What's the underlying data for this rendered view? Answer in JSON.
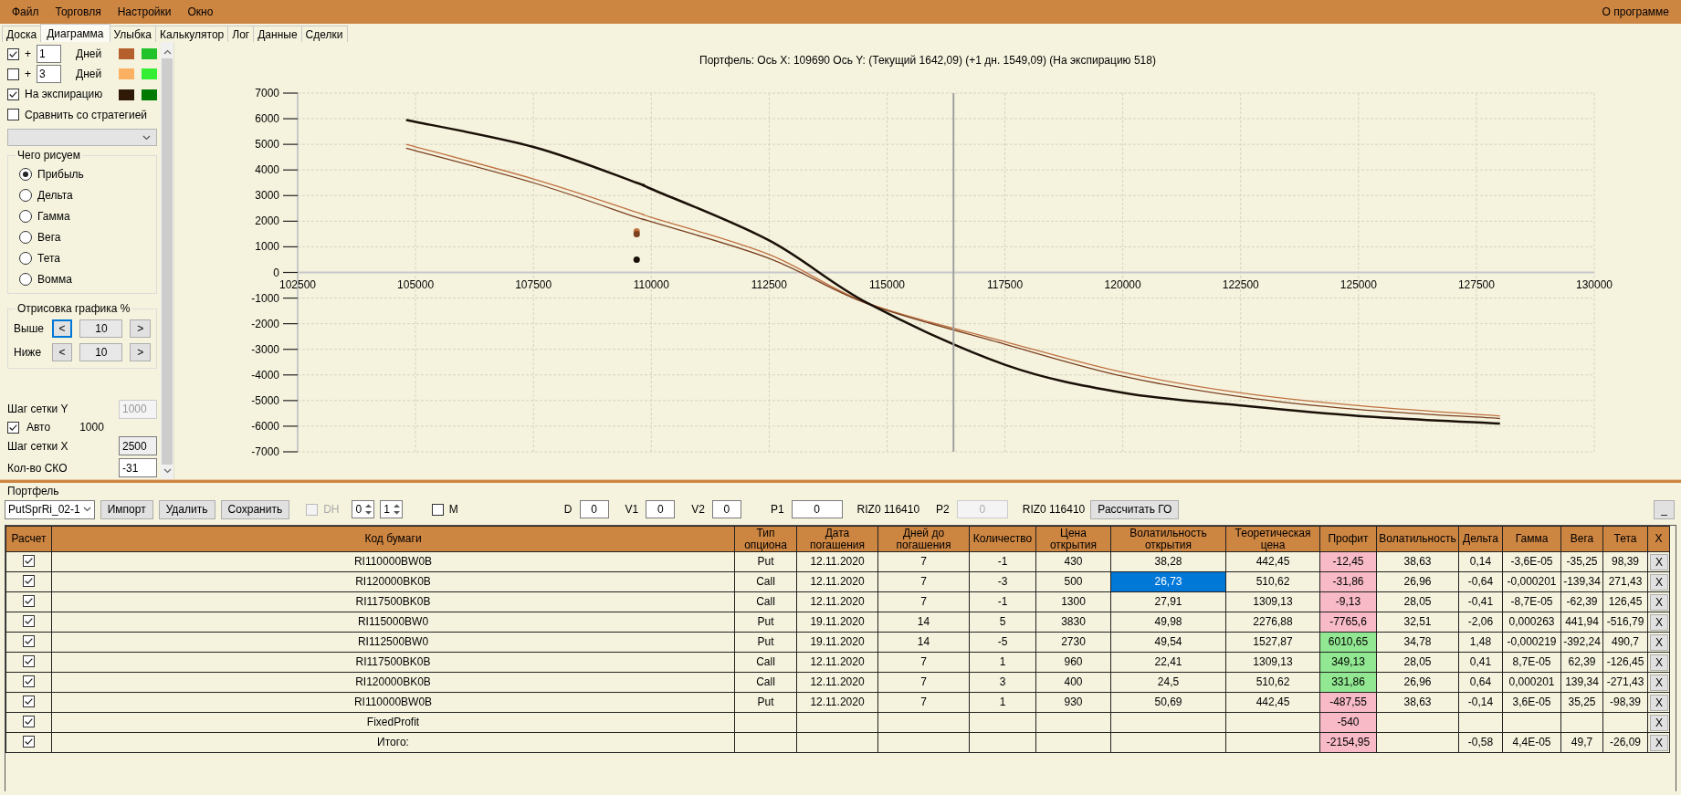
{
  "menu": {
    "items": [
      "Файл",
      "Торговля",
      "Настройки",
      "Окно"
    ],
    "about": "О программе"
  },
  "tabs": [
    {
      "label": "Доска",
      "selected": false
    },
    {
      "label": "Диаграмма",
      "selected": true
    },
    {
      "label": "Улыбка",
      "selected": false
    },
    {
      "label": "Калькулятор",
      "selected": false
    },
    {
      "label": "Лог",
      "selected": false
    },
    {
      "label": "Данные",
      "selected": false
    },
    {
      "label": "Сделки",
      "selected": false
    }
  ],
  "settings": {
    "curve_rows": [
      {
        "kind": "days",
        "checked": true,
        "sign": "+",
        "days": "1",
        "unit": "Дней",
        "swatches": [
          {
            "color": "#b5602c"
          },
          {
            "color": "#22c22a"
          }
        ]
      },
      {
        "kind": "days",
        "checked": false,
        "sign": "+",
        "days": "3",
        "unit": "Дней",
        "swatches": [
          {
            "color": "#fbb062"
          },
          {
            "color": "#33ee33"
          }
        ]
      },
      {
        "kind": "expiry",
        "checked": true,
        "label": "На экспирацию",
        "swatches": [
          {
            "color": "#301806"
          },
          {
            "color": "#007a00"
          }
        ]
      }
    ],
    "compare": {
      "label": "Сравнить со стратегией",
      "checked": false
    },
    "draw_group": {
      "title": "Чего рисуем",
      "options": [
        {
          "label": "Прибыль",
          "selected": true
        },
        {
          "label": "Дельта",
          "selected": false
        },
        {
          "label": "Гамма",
          "selected": false
        },
        {
          "label": "Вега",
          "selected": false
        },
        {
          "label": "Тета",
          "selected": false
        },
        {
          "label": "Вомма",
          "selected": false
        }
      ]
    },
    "range_group": {
      "title": "Отрисовка графика %",
      "rows": [
        {
          "label": "Выше",
          "dec": "<",
          "value": "10",
          "inc": ">",
          "focused": true
        },
        {
          "label": "Ниже",
          "dec": "<",
          "value": "10",
          "inc": ">",
          "focused": false
        }
      ]
    },
    "grid_y": {
      "label": "Шаг сетки Y",
      "value": "1000",
      "disabled": true
    },
    "auto": {
      "label": "Авто",
      "checked": true,
      "value": "1000"
    },
    "grid_x": {
      "label": "Шаг сетки X",
      "value": "2500",
      "readonly": true
    },
    "sko": {
      "label": "Кол-во СКО",
      "value": "-31"
    }
  },
  "chart": {
    "chart_data": {
      "type": "line",
      "title": "Портфель: Ось X: 109690 Ось Y:  (Текущий 1642,09)  (+1 дн. 1549,09)  (На экспирацию 518)",
      "x": [
        104800,
        107500,
        109690,
        110000,
        112500,
        114600,
        117500,
        120000,
        122500,
        125000,
        128000
      ],
      "series": [
        {
          "color": "#c07040",
          "values": [
            5000,
            3650,
            2350,
            2150,
            700,
            -1210,
            -2700,
            -3900,
            -4700,
            -5200,
            -5600
          ]
        },
        {
          "color": "#7a4020",
          "values": [
            4850,
            3500,
            2150,
            1980,
            550,
            -1230,
            -2800,
            -4050,
            -4850,
            -5350,
            -5700
          ]
        },
        {
          "color": "#1a1008",
          "values": [
            5950,
            4900,
            3500,
            3260,
            1250,
            -1210,
            -3600,
            -4690,
            -5190,
            -5600,
            -5900
          ]
        },
        {
          "color": "#c07040",
          "marker": true,
          "values": [
            null,
            null,
            1600,
            null,
            null,
            null,
            null,
            null,
            null,
            null,
            null
          ]
        },
        {
          "color": "#7a4020",
          "marker": true,
          "values": [
            null,
            null,
            1500,
            null,
            null,
            null,
            null,
            null,
            null,
            null,
            null
          ]
        },
        {
          "color": "#1a1008",
          "marker": true,
          "values": [
            null,
            null,
            500,
            null,
            null,
            null,
            null,
            null,
            null,
            null,
            null
          ]
        }
      ],
      "xlim": [
        102500,
        130000
      ],
      "ylim": [
        -7000,
        7000
      ],
      "grid": true,
      "xticks": [
        {
          "value": 102500,
          "label": "102500"
        },
        {
          "value": 105000,
          "label": "105000"
        },
        {
          "value": 107500,
          "label": "107500"
        },
        {
          "value": 110000,
          "label": "110000"
        },
        {
          "value": 112500,
          "label": "112500"
        },
        {
          "value": 115000,
          "label": "115000"
        },
        {
          "value": 117500,
          "label": "117500"
        },
        {
          "value": 120000,
          "label": "120000"
        },
        {
          "value": 122500,
          "label": "122500"
        },
        {
          "value": 125000,
          "label": "125000"
        },
        {
          "value": 127500,
          "label": "127500"
        },
        {
          "value": 130000,
          "label": "130000"
        }
      ],
      "yticks": [
        {
          "value": -7000,
          "label": "-7000"
        },
        {
          "value": -6000,
          "label": "-6000"
        },
        {
          "value": -5000,
          "label": "-5000"
        },
        {
          "value": -4000,
          "label": "-4000"
        },
        {
          "value": -3000,
          "label": "-3000"
        },
        {
          "value": -2000,
          "label": "-2000"
        },
        {
          "value": -1000,
          "label": "-1000"
        },
        {
          "value": 0,
          "label": "0"
        },
        {
          "value": 1000,
          "label": "1000"
        },
        {
          "value": 2000,
          "label": "2000"
        },
        {
          "value": 3000,
          "label": "3000"
        },
        {
          "value": 4000,
          "label": "4000"
        },
        {
          "value": 5000,
          "label": "5000"
        },
        {
          "value": 6000,
          "label": "6000"
        },
        {
          "value": 7000,
          "label": "7000"
        }
      ],
      "ref_lines": [
        {
          "axis": "x",
          "value": 116410
        }
      ]
    }
  },
  "portfolio": {
    "title": "Портфель",
    "toolbar": {
      "portfolio_select": "PutSprRi_02-1",
      "buttons": [
        "Импорт",
        "Удалить",
        "Сохранить"
      ],
      "dh": {
        "label": "DH",
        "checked": false,
        "disabled": true
      },
      "spinners": [
        "0",
        "1"
      ],
      "m": {
        "label": "M",
        "checked": false,
        "disabled": false
      },
      "fields": [
        {
          "kind": "field",
          "label": "D",
          "value": "0",
          "disabled": false
        },
        {
          "kind": "field",
          "label": "V1",
          "value": "0",
          "disabled": false
        },
        {
          "kind": "field",
          "label": "V2",
          "value": "0",
          "disabled": false
        },
        {
          "kind": "field",
          "label": "P1",
          "value": "0",
          "disabled": false
        },
        {
          "kind": "quote",
          "text": "RIZ0 116410"
        },
        {
          "kind": "field",
          "label": "P2",
          "value": "0",
          "disabled": true
        },
        {
          "kind": "quote",
          "text": "RIZ0 116410"
        }
      ],
      "calc_button": "Рассчитать ГО",
      "minimize_button": "_"
    },
    "table": {
      "columns": [
        "Расчет",
        "Код бумаги",
        "Тип опциона",
        "Дата погашения",
        "Дней до погашения",
        "Количество",
        "Цена открытия",
        "Волатильность открытия",
        "Теоретическая цена",
        "Профит",
        "Волатильность",
        "Дельта",
        "Гамма",
        "Вега",
        "Тета",
        "X"
      ],
      "rows": [
        {
          "calc": true,
          "code": "RI110000BW0B",
          "type": "Put",
          "date": "12.11.2020",
          "days": "7",
          "qty": "-1",
          "open_price": "430",
          "open_vol": "38,28",
          "open_vol_selected": false,
          "theor": "442,45",
          "profit": "-12,45",
          "color": "#f7bac6",
          "vol": "38,63",
          "delta": "0,14",
          "gamma": "-3,6E-05",
          "vega": "-35,25",
          "theta": "98,39",
          "del": "X"
        },
        {
          "calc": true,
          "code": "RI120000BK0B",
          "type": "Call",
          "date": "12.11.2020",
          "days": "7",
          "qty": "-3",
          "open_price": "500",
          "open_vol": "26,73",
          "open_vol_selected": true,
          "theor": "510,62",
          "profit": "-31,86",
          "color": "#f7bac6",
          "vol": "26,96",
          "delta": "-0,64",
          "gamma": "-0,000201",
          "vega": "-139,34",
          "theta": "271,43",
          "del": "X"
        },
        {
          "calc": true,
          "code": "RI117500BK0B",
          "type": "Call",
          "date": "12.11.2020",
          "days": "7",
          "qty": "-1",
          "open_price": "1300",
          "open_vol": "27,91",
          "open_vol_selected": false,
          "theor": "1309,13",
          "profit": "-9,13",
          "color": "#f7bac6",
          "vol": "28,05",
          "delta": "-0,41",
          "gamma": "-8,7E-05",
          "vega": "-62,39",
          "theta": "126,45",
          "del": "X"
        },
        {
          "calc": true,
          "code": "RI115000BW0",
          "type": "Put",
          "date": "19.11.2020",
          "days": "14",
          "qty": "5",
          "open_price": "3830",
          "open_vol": "49,98",
          "open_vol_selected": false,
          "theor": "2276,88",
          "profit": "-7765,6",
          "color": "#f7bac6",
          "vol": "32,51",
          "delta": "-2,06",
          "gamma": "0,000263",
          "vega": "441,94",
          "theta": "-516,79",
          "del": "X"
        },
        {
          "calc": true,
          "code": "RI112500BW0",
          "type": "Put",
          "date": "19.11.2020",
          "days": "14",
          "qty": "-5",
          "open_price": "2730",
          "open_vol": "49,54",
          "open_vol_selected": false,
          "theor": "1527,87",
          "profit": "6010,65",
          "color": "#92e892",
          "vol": "34,78",
          "delta": "1,48",
          "gamma": "-0,000219",
          "vega": "-392,24",
          "theta": "490,7",
          "del": "X"
        },
        {
          "calc": true,
          "code": "RI117500BK0B",
          "type": "Call",
          "date": "12.11.2020",
          "days": "7",
          "qty": "1",
          "open_price": "960",
          "open_vol": "22,41",
          "open_vol_selected": false,
          "theor": "1309,13",
          "profit": "349,13",
          "color": "#92e892",
          "vol": "28,05",
          "delta": "0,41",
          "gamma": "8,7E-05",
          "vega": "62,39",
          "theta": "-126,45",
          "del": "X"
        },
        {
          "calc": true,
          "code": "RI120000BK0B",
          "type": "Call",
          "date": "12.11.2020",
          "days": "7",
          "qty": "3",
          "open_price": "400",
          "open_vol": "24,5",
          "open_vol_selected": false,
          "theor": "510,62",
          "profit": "331,86",
          "color": "#92e892",
          "vol": "26,96",
          "delta": "0,64",
          "gamma": "0,000201",
          "vega": "139,34",
          "theta": "-271,43",
          "del": "X"
        },
        {
          "calc": true,
          "code": "RI110000BW0B",
          "type": "Put",
          "date": "12.11.2020",
          "days": "7",
          "qty": "1",
          "open_price": "930",
          "open_vol": "50,69",
          "open_vol_selected": false,
          "theor": "442,45",
          "profit": "-487,55",
          "color": "#f7bac6",
          "vol": "38,63",
          "delta": "-0,14",
          "gamma": "3,6E-05",
          "vega": "35,25",
          "theta": "-98,39",
          "del": "X"
        },
        {
          "calc": true,
          "code": "FixedProfit",
          "profit": "-540",
          "color": "#f7bac6",
          "del": "X"
        },
        {
          "calc": true,
          "code": "Итого:",
          "profit": "-2154,95",
          "color": "#f7bac6",
          "delta": "-0,58",
          "gamma": "4,4E-05",
          "vega": "49,7",
          "theta": "-26,09",
          "del": "X"
        }
      ]
    }
  }
}
